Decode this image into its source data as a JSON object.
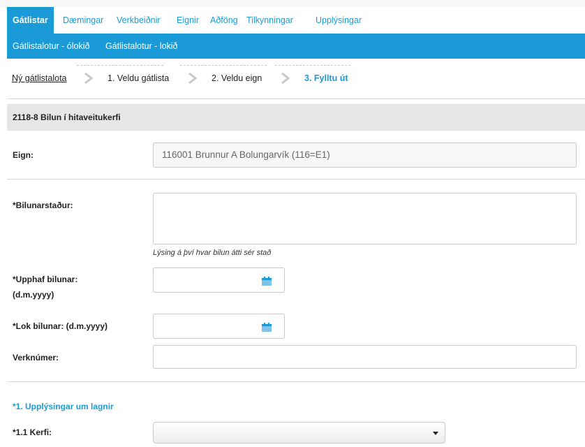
{
  "main_nav": {
    "active": "Gátlistar",
    "items": [
      "Dæmingar",
      "Verkbeiðnir",
      "Eignir",
      "Aðföng",
      "Tilkynningar",
      "Upplýsingar"
    ]
  },
  "sub_nav": {
    "items": [
      "Gátlistalotur - ólokið",
      "Gátlistalotur - lokið"
    ]
  },
  "breadcrumb": {
    "root": "Ný gátlistalota",
    "step1": "1. Veldu gátlista",
    "step2": "2. Veldu eign",
    "step3": "3. Fylltu út"
  },
  "form": {
    "title": "2118-8 Bilun í hitaveitukerfi",
    "eign_label": "Eign:",
    "eign_value": "116001 Brunnur A Bolungarvík (116=E1)",
    "location_label": "*Bilunarstaður:",
    "location_value": "",
    "location_hint": "Lýsing á því hvar bilun átti sér stað",
    "start_label_line1": "*Upphaf bilunar:",
    "start_label_line2": "(d.m.yyyy)",
    "start_value": "",
    "end_label": "*Lok bilunar: (d.m.yyyy)",
    "end_value": "",
    "job_label": "Verknúmer:",
    "job_value": "",
    "section1_title": "*1. Upplýsingar um lagnir",
    "system_label": "*1.1 Kerfi:",
    "system_value": ""
  },
  "icons": {
    "calendar": "calendar-icon",
    "arrow": "chevron-right-icon",
    "dropdown": "caret-down-icon"
  },
  "colors": {
    "accent": "#1a9bd7",
    "section_bg": "#e6e6e6"
  }
}
